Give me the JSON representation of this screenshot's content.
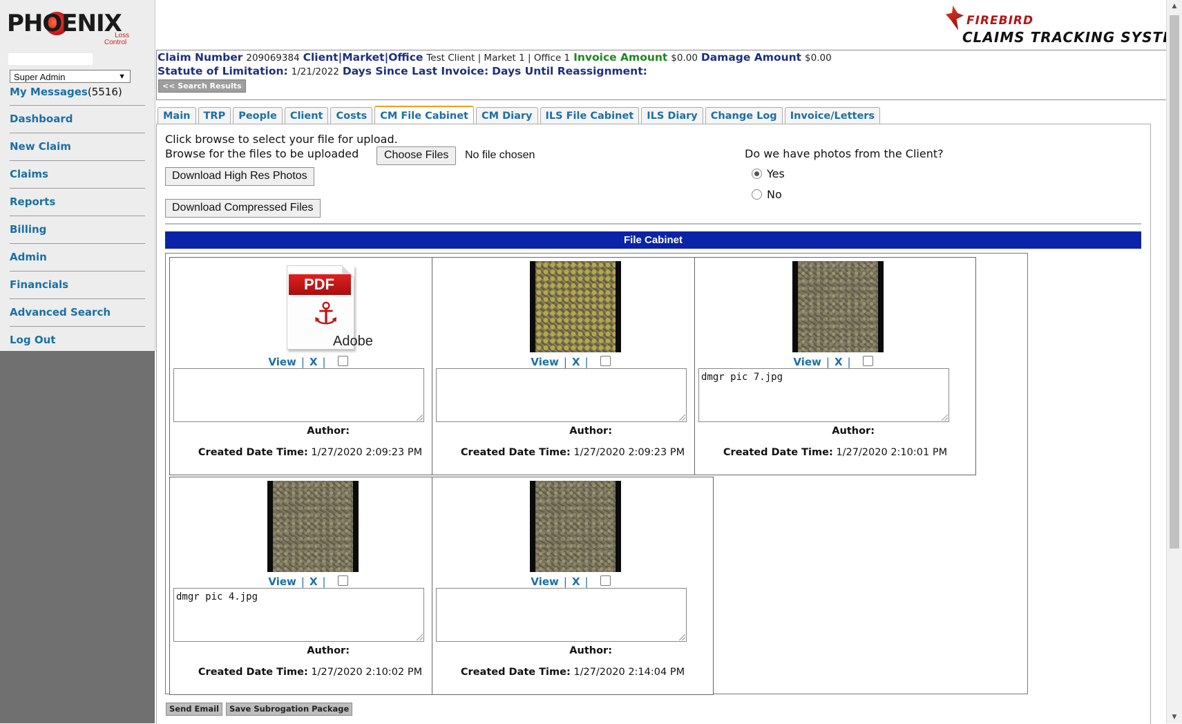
{
  "brand": {
    "logo_word": "PHOENIX",
    "logo_sub1": "Loss",
    "logo_sub2": "Control",
    "firebird_line1": "FIREBIRD",
    "firebird_line2": "CLAIMS TRACKING SYSTEM"
  },
  "sidebar": {
    "role_selected": "Super Admin",
    "messages_label": "My Messages",
    "messages_count": "(5516)",
    "items": [
      {
        "label": "Dashboard"
      },
      {
        "label": "New Claim"
      },
      {
        "label": "Claims"
      },
      {
        "label": "Reports"
      },
      {
        "label": "Billing"
      },
      {
        "label": "Admin"
      },
      {
        "label": "Financials"
      },
      {
        "label": "Advanced Search"
      },
      {
        "label": "Log Out"
      }
    ]
  },
  "claim": {
    "claim_number_label": "Claim Number",
    "claim_number": "209069384",
    "client_label": "Client|Market|Office",
    "client_value": "Test Client | Market 1 | Office 1",
    "invoice_label": "Invoice Amount",
    "invoice_value": "$0.00",
    "damage_label": "Damage Amount",
    "damage_value": "$0.00",
    "statute_label": "Statute of Limitation:",
    "statute_value": "1/21/2022",
    "days_since_label": "Days Since Last Invoice:",
    "days_until_label": "Days Until Reassignment:",
    "search_results_btn": "<< Search Results"
  },
  "tabs": [
    {
      "label": "Main",
      "active": false
    },
    {
      "label": "TRP",
      "active": false
    },
    {
      "label": "People",
      "active": false
    },
    {
      "label": "Client",
      "active": false
    },
    {
      "label": "Costs",
      "active": false
    },
    {
      "label": "CM File Cabinet",
      "active": true
    },
    {
      "label": "CM Diary",
      "active": false
    },
    {
      "label": "ILS File Cabinet",
      "active": false
    },
    {
      "label": "ILS Diary",
      "active": false
    },
    {
      "label": "Change Log",
      "active": false
    },
    {
      "label": "Invoice/Letters",
      "active": false
    }
  ],
  "upload": {
    "intro": "Click browse to select your file for upload.",
    "browse_label": "Browse for the files to be uploaded",
    "choose_button": "Choose Files",
    "no_file": "No file chosen",
    "download_high_res": "Download High Res Photos",
    "download_compressed": "Download Compressed Files",
    "photos_question": "Do we have photos from the Client?",
    "radio_yes": "Yes",
    "radio_no": "No",
    "radio_selected": "Yes"
  },
  "file_cabinet": {
    "header": "File Cabinet",
    "view_label": "View",
    "delete_label": "X",
    "author_label": "Author:",
    "created_label": "Created Date Time:",
    "pdf_badge": "PDF",
    "pdf_brand": "Adobe",
    "files": [
      {
        "kind": "pdf",
        "comment": "",
        "created": "1/27/2020 2:09:23 PM"
      },
      {
        "kind": "photo-yellow",
        "comment": "",
        "created": "1/27/2020 2:09:23 PM"
      },
      {
        "kind": "photo",
        "comment": "dmgr pic 7.jpg",
        "created": "1/27/2020 2:10:01 PM"
      },
      {
        "kind": "photo",
        "comment": "dmgr pic 4.jpg",
        "created": "1/27/2020 2:10:02 PM"
      },
      {
        "kind": "photo",
        "comment": "",
        "created": "1/27/2020 2:14:04 PM"
      }
    ]
  },
  "bottom_buttons": {
    "send_email": "Send Email",
    "save_subrogation": "Save Subrogation Package"
  },
  "colors": {
    "nav_link": "#1b6fa6",
    "label_blue": "#1d2f80",
    "label_green": "#1a8a1a",
    "cabinet_header": "#0a23a8",
    "active_tab_accent": "#f39c1a",
    "sidebar_gray": "#707070"
  }
}
